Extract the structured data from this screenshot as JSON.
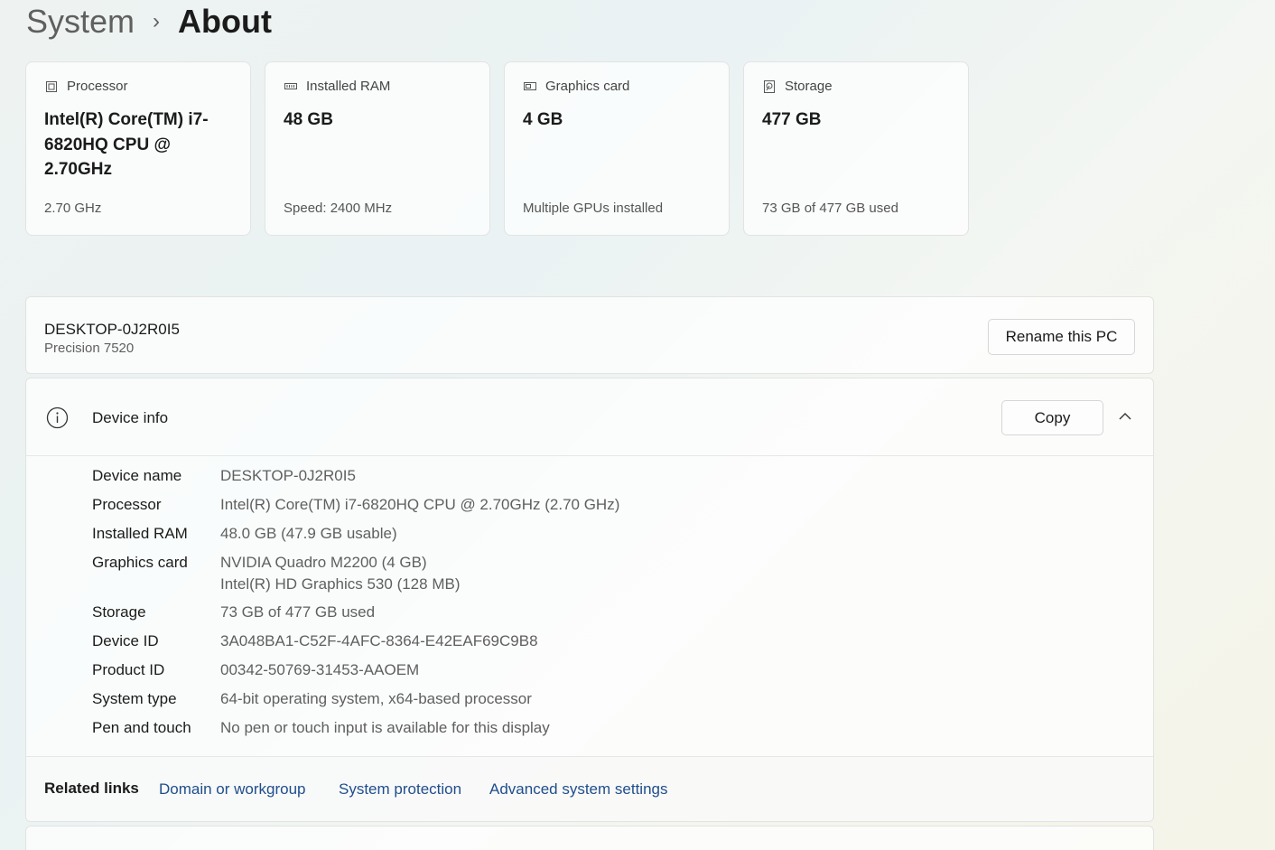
{
  "breadcrumb": {
    "parent": "System",
    "separator": "›",
    "current": "About"
  },
  "specs": [
    {
      "label": "Processor",
      "icon": "processor-icon",
      "value": "Intel(R) Core(TM) i7-6820HQ CPU @ 2.70GHz",
      "sub": "2.70 GHz"
    },
    {
      "label": "Installed RAM",
      "icon": "ram-icon",
      "value": "48 GB",
      "sub": "Speed: 2400 MHz"
    },
    {
      "label": "Graphics card",
      "icon": "graphics-card-icon",
      "value": "4 GB",
      "sub": "Multiple GPUs installed"
    },
    {
      "label": "Storage",
      "icon": "storage-icon",
      "value": "477 GB",
      "sub": "73 GB of 477 GB used"
    }
  ],
  "pc": {
    "name": "DESKTOP-0J2R0I5",
    "model": "Precision 7520",
    "rename_label": "Rename this PC"
  },
  "device_info": {
    "title": "Device info",
    "copy_label": "Copy",
    "rows": [
      {
        "label": "Device name",
        "value": "DESKTOP-0J2R0I5"
      },
      {
        "label": "Processor",
        "value": "Intel(R) Core(TM) i7-6820HQ CPU @ 2.70GHz (2.70 GHz)"
      },
      {
        "label": "Installed RAM",
        "value": "48.0 GB (47.9 GB usable)"
      },
      {
        "label": "Graphics card",
        "value": "NVIDIA Quadro M2200 (4 GB)",
        "value2": "Intel(R) HD Graphics 530 (128 MB)"
      },
      {
        "label": "Storage",
        "value": "73 GB of 477 GB used"
      },
      {
        "label": "Device ID",
        "value": "3A048BA1-C52F-4AFC-8364-E42EAF69C9B8"
      },
      {
        "label": "Product ID",
        "value": "00342-50769-31453-AAOEM"
      },
      {
        "label": "System type",
        "value": "64-bit operating system, x64-based processor"
      },
      {
        "label": "Pen and touch",
        "value": "No pen or touch input is available for this display"
      }
    ]
  },
  "related": {
    "label": "Related links",
    "links": [
      "Domain or workgroup",
      "System protection",
      "Advanced system settings"
    ]
  }
}
